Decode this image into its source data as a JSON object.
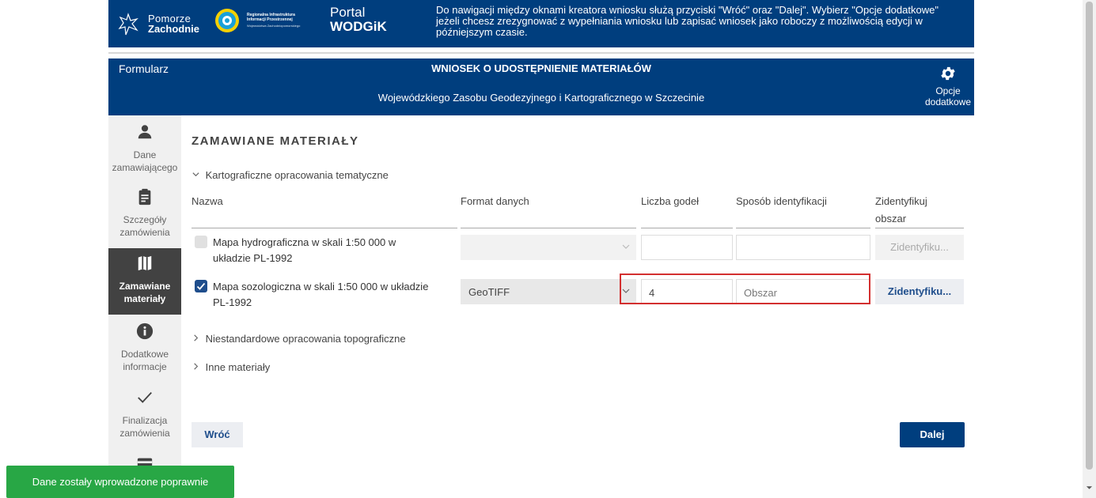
{
  "header": {
    "logo_pomorze_line1": "Pomorze",
    "logo_pomorze_line2": "Zachodnie",
    "logo_riip_line1": "Regionalna Infrastruktura Informacji Przestrzennej",
    "logo_riip_line2": "Województwa Zachodniopomorskiego",
    "portal_line1": "Portal",
    "portal_line2": "WODGiK",
    "message": "Do nawigacji między oknami kreatora wniosku służą przyciski \"Wróć\" oraz \"Dalej\". Wybierz \"Opcje dodatkowe\" jeżeli chcesz zrezygnować z wypełniania wniosku lub zapisać wniosek jako roboczy z możliwością edycji w późniejszym czasie."
  },
  "form_header": {
    "label": "Formularz",
    "title": "WNIOSEK O UDOSTĘPNIENIE MATERIAŁÓW",
    "subtitle": "Wojewódzkiego Zasobu Geodezyjnego i Kartograficznego w Szczecinie",
    "options_line1": "Opcje",
    "options_line2": "dodatkowe"
  },
  "sidebar": {
    "items": [
      {
        "line1": "Dane",
        "line2": "zamawiającego",
        "icon": "user-icon"
      },
      {
        "line1": "Szczegóły",
        "line2": "zamówienia",
        "icon": "clipboard-icon"
      },
      {
        "line1": "Zamawiane",
        "line2": "materiały",
        "icon": "map-icon",
        "active": true
      },
      {
        "line1": "Dodatkowe",
        "line2": "informacje",
        "icon": "info-icon"
      },
      {
        "line1": "Finalizacja",
        "line2": "zamówienia",
        "icon": "check-icon"
      }
    ]
  },
  "main": {
    "section_title": "ZAMAWIANE MATERIAŁY",
    "categories": [
      {
        "label": "Kartograficzne opracowania tematyczne",
        "expanded": true
      },
      {
        "label": "Niestandardowe opracowania topograficzne",
        "expanded": false
      },
      {
        "label": "Inne materiały",
        "expanded": false
      }
    ],
    "columns": [
      "Nazwa",
      "Format danych",
      "Liczba godeł",
      "Sposób identyfikacji",
      "Zidentyfikuj obszar"
    ],
    "rows": [
      {
        "checked": false,
        "name_line1": "Mapa hydrograficzna w skali 1:50 000 w",
        "name_line2": "układzie PL-1992",
        "format": "",
        "count": "",
        "identification": "",
        "identify_button": "Zidentyfiku..."
      },
      {
        "checked": true,
        "name_line1": "Mapa sozologiczna w skali 1:50 000 w układzie",
        "name_line2": "PL-1992",
        "format": "GeoTIFF",
        "count": "4",
        "identification": "Obszar",
        "identify_button": "Zidentyfiku..."
      }
    ],
    "back_label": "Wróć",
    "next_label": "Dalej"
  },
  "toast": {
    "message": "Dane zostały wprowadzone poprawnie",
    "color": "#28a745"
  },
  "colors": {
    "brand": "#003e7e",
    "accent": "#1f4e8c",
    "highlight": "#d32f2f"
  }
}
